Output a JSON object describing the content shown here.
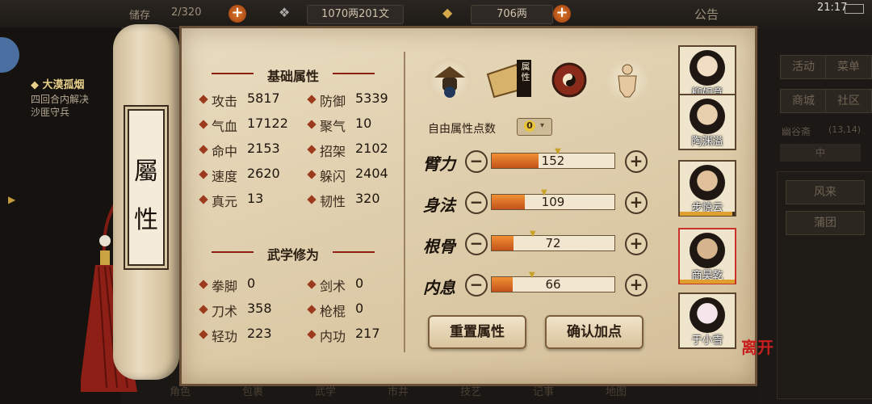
{
  "topbar": {
    "bag_label": "储存",
    "bag_count": "2/320",
    "money": "1070两201文",
    "gold": "706两",
    "notice": "公告",
    "time": "21:17"
  },
  "quest": {
    "title": "大漠孤烟",
    "line1": "四回合内解决",
    "line2": "沙匪守兵"
  },
  "scroll": {
    "char1": "屬",
    "char2": "性"
  },
  "basic": {
    "title": "基础属性",
    "stats": [
      {
        "label": "攻击",
        "value": "5817"
      },
      {
        "label": "防御",
        "value": "5339"
      },
      {
        "label": "气血",
        "value": "17122"
      },
      {
        "label": "聚气",
        "value": "10"
      },
      {
        "label": "命中",
        "value": "2153"
      },
      {
        "label": "招架",
        "value": "2102"
      },
      {
        "label": "速度",
        "value": "2620"
      },
      {
        "label": "躲闪",
        "value": "2404"
      },
      {
        "label": "真元",
        "value": "13"
      },
      {
        "label": "韧性",
        "value": "320"
      }
    ]
  },
  "martial": {
    "title": "武学修为",
    "stats": [
      {
        "label": "拳脚",
        "value": "0"
      },
      {
        "label": "剑术",
        "value": "0"
      },
      {
        "label": "刀术",
        "value": "358"
      },
      {
        "label": "枪棍",
        "value": "0"
      },
      {
        "label": "轻功",
        "value": "223"
      },
      {
        "label": "内功",
        "value": "217"
      }
    ]
  },
  "tabs": {
    "active_label": "属性",
    "icons": [
      "hat-icon",
      "attribute-scroll-icon",
      "bagua-icon",
      "body-meridian-icon"
    ]
  },
  "free_points": {
    "label": "自由属性点数",
    "value": "0"
  },
  "attributes": [
    {
      "name": "臂力",
      "value": "152",
      "fill": 0.38
    },
    {
      "name": "身法",
      "value": "109",
      "fill": 0.27
    },
    {
      "name": "根骨",
      "value": "72",
      "fill": 0.18
    },
    {
      "name": "内息",
      "value": "66",
      "fill": 0.17
    }
  ],
  "buttons": {
    "reset": "重置属性",
    "confirm": "确认加点"
  },
  "characters": [
    {
      "name": "柳如意",
      "hp": 0
    },
    {
      "name": "陶渊溢",
      "hp": 0
    },
    {
      "name": "步惊云",
      "hp": 0.95
    },
    {
      "name": "商昊乾",
      "hp": 1.0
    },
    {
      "name": "于小雪",
      "hp": 0
    }
  ],
  "right_menu": {
    "activity": "活动",
    "menu": "菜单",
    "shop": "商城",
    "community": "社区",
    "location": "幽谷斋",
    "coords": "(13,14)",
    "tab": "中",
    "item1": "风来",
    "item2": "蒲团"
  },
  "leave_label": "离开",
  "bottom_nav": [
    "角色",
    "包裹",
    "武学",
    "市井",
    "技艺",
    "记事",
    "地图"
  ]
}
